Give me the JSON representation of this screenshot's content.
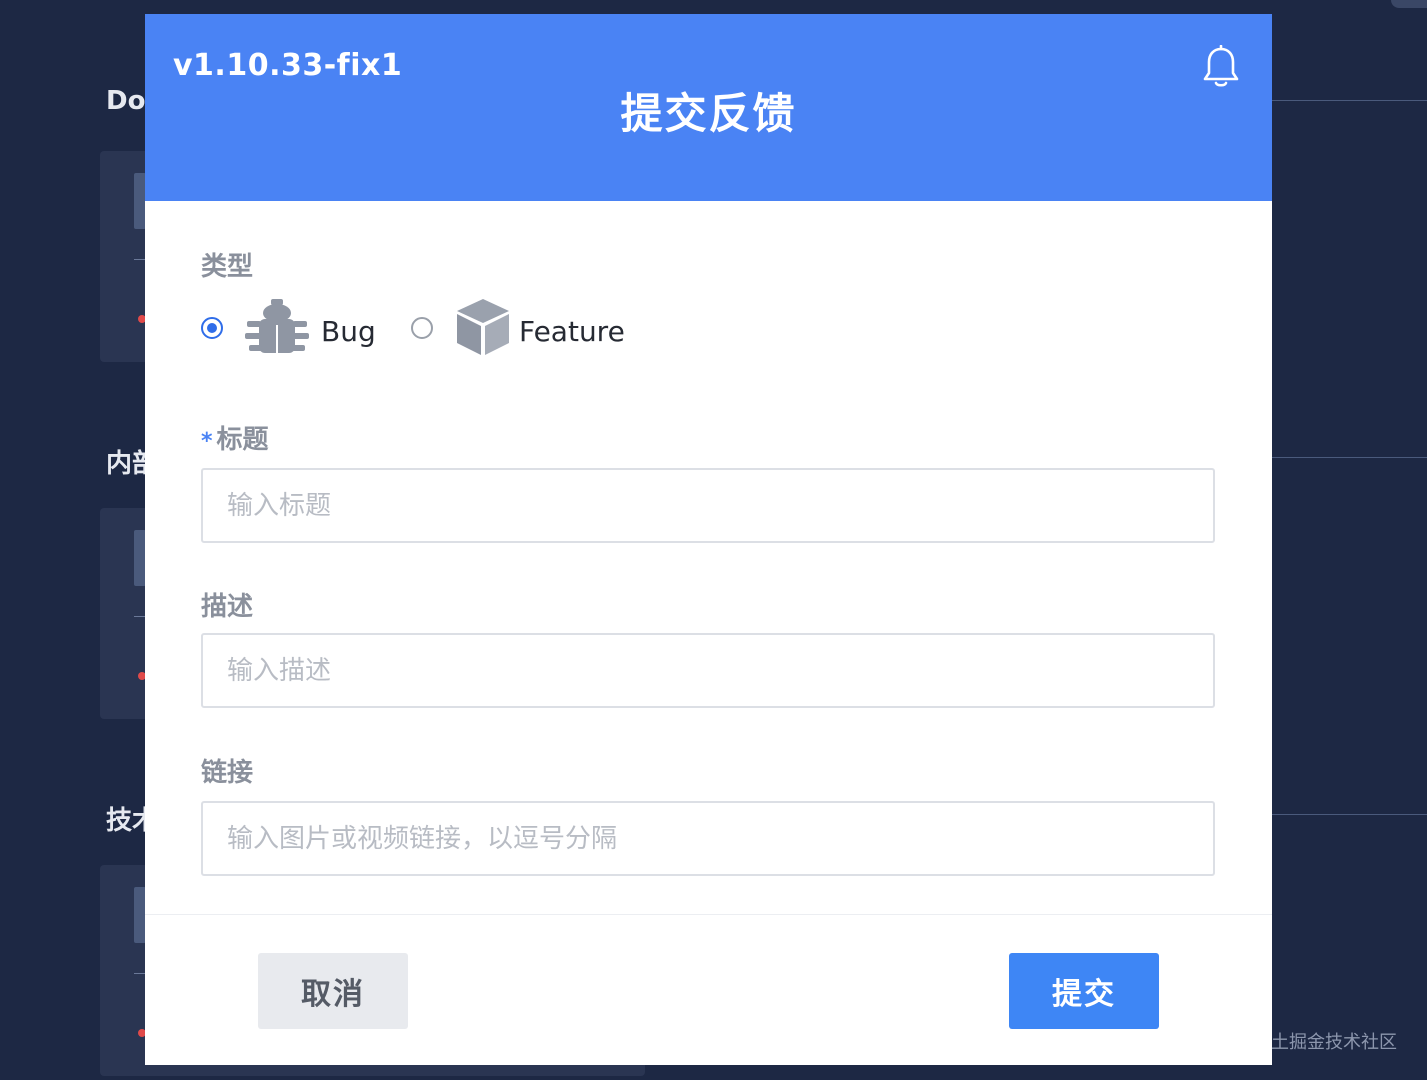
{
  "background": {
    "sections": [
      "Doc",
      "内部",
      "技术"
    ]
  },
  "modal": {
    "version": "v1.10.33-fix1",
    "title": "提交反馈",
    "type_label": "类型",
    "type_options": [
      {
        "label": "Bug",
        "icon": "bug-icon",
        "checked": true
      },
      {
        "label": "Feature",
        "icon": "cube-icon",
        "checked": false
      }
    ],
    "title_field": {
      "required_mark": "*",
      "label": "标题",
      "placeholder": "输入标题",
      "value": ""
    },
    "description_field": {
      "label": "描述",
      "placeholder": "输入描述",
      "value": ""
    },
    "link_field": {
      "label": "链接",
      "placeholder": "输入图片或视频链接，以逗号分隔",
      "value": ""
    },
    "cancel_label": "取消",
    "submit_label": "提交"
  },
  "watermark": "@稀土掘金技术社区",
  "colors": {
    "header": "#4a83f4",
    "primary": "#3e86f5",
    "page_bg": "#1d2844"
  }
}
